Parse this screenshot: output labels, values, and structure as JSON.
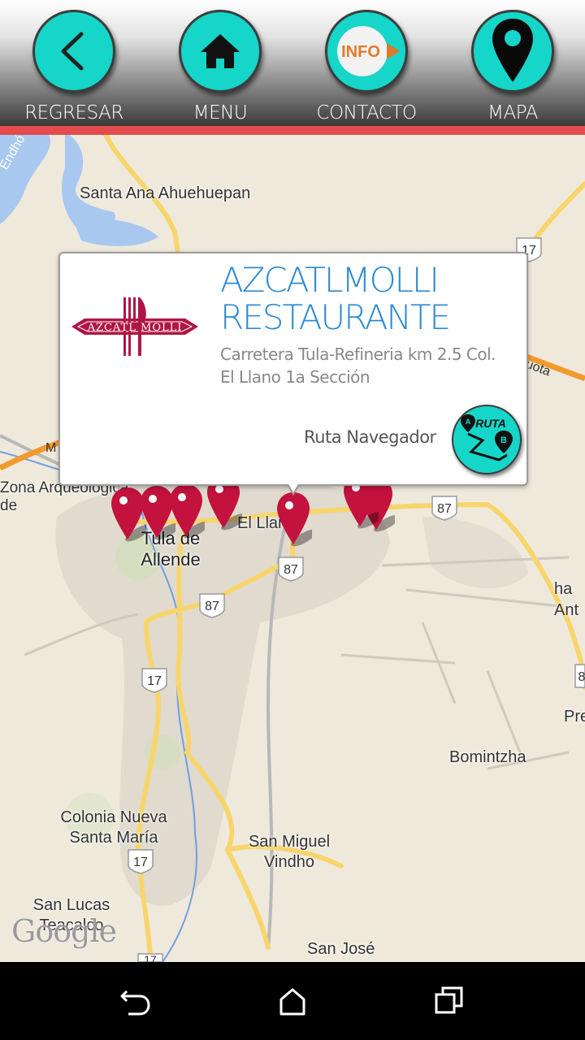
{
  "header": {
    "buttons": [
      {
        "label": "REGRESAR",
        "icon": "back-chevron-icon"
      },
      {
        "label": "MENU",
        "icon": "home-icon"
      },
      {
        "label": "CONTACTO",
        "icon": "info-icon",
        "icon_text": "INFO"
      },
      {
        "label": "MAPA",
        "icon": "map-pin-icon"
      }
    ],
    "accent_color": "#15d6c8",
    "bar_color": "#e34b4f"
  },
  "map": {
    "places": [
      "Santa Ana Ahuehuepan",
      "Zona Arqueológica de",
      "Tula de Allende",
      "El Llano",
      "Bomintzha",
      "Colonia Nueva Santa María",
      "San Miguel Vindho",
      "San Lucas Teacalco",
      "San José",
      "ha Ant",
      "Pre"
    ],
    "road_labels": [
      "Endhó",
      "M",
      "uota"
    ],
    "highway_shields": [
      "17",
      "87",
      "87",
      "87",
      "17",
      "17",
      "17",
      "8"
    ],
    "watermark": "Google",
    "marker_color": "#c2123d"
  },
  "popup": {
    "logo_text": "AZCATL MOLLI",
    "title": "AZCATLMOLLI RESTAURANTE",
    "address": "Carretera Tula-Refineria km 2.5 Col. El Llano 1a Sección",
    "route_label": "Ruta Navegador",
    "route_button_text": "RUTA",
    "route_point_a": "A",
    "route_point_b": "B"
  },
  "system_nav": {
    "buttons": [
      "back-icon",
      "home-icon",
      "recents-icon"
    ]
  }
}
